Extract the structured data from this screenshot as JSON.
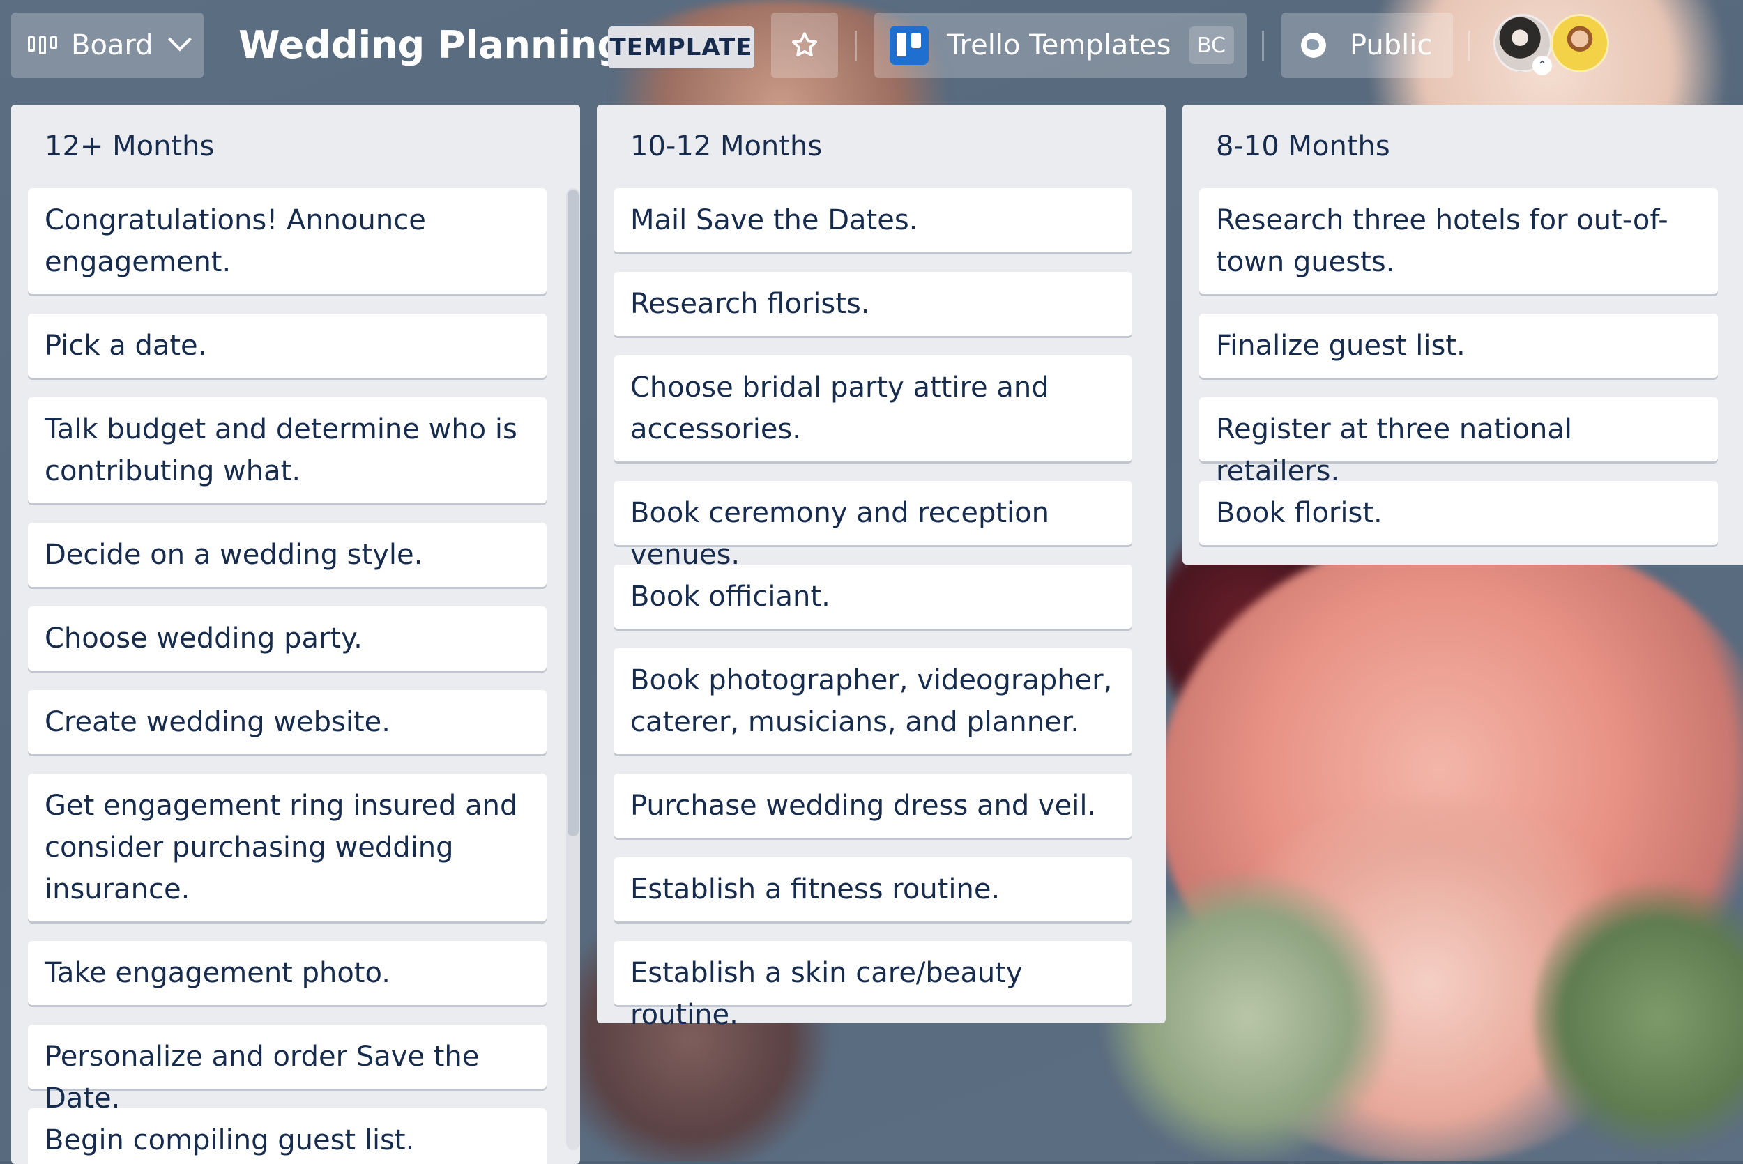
{
  "header": {
    "view_label": "Board",
    "board_title": "Wedding Planning",
    "template_badge": "TEMPLATE",
    "workspace_name": "Trello Templates",
    "workspace_badge": "BC",
    "visibility_label": "Public"
  },
  "lists": [
    {
      "title": "12+ Months",
      "cards": [
        "Congratulations! Announce engagement.",
        "Pick a date.",
        "Talk budget and determine who is contributing what.",
        "Decide on a wedding style.",
        "Choose wedding party.",
        "Create wedding website.",
        "Get engagement ring insured and consider purchasing wedding insurance.",
        "Take engagement photo.",
        "Personalize and order Save the Date.",
        "Begin compiling guest list."
      ]
    },
    {
      "title": "10-12 Months",
      "cards": [
        "Mail Save the Dates.",
        "Research florists.",
        "Choose bridal party attire and accessories.",
        "Book ceremony and reception venues.",
        "Book officiant.",
        "Book photographer, videographer, caterer, musicians, and planner.",
        "Purchase wedding dress and veil.",
        "Establish a fitness routine.",
        "Establish a skin care/beauty routine."
      ]
    },
    {
      "title": "8-10 Months",
      "cards": [
        "Research three hotels for out-of-town guests.",
        "Finalize guest list.",
        "Register at three national retailers.",
        "Book florist."
      ]
    }
  ]
}
